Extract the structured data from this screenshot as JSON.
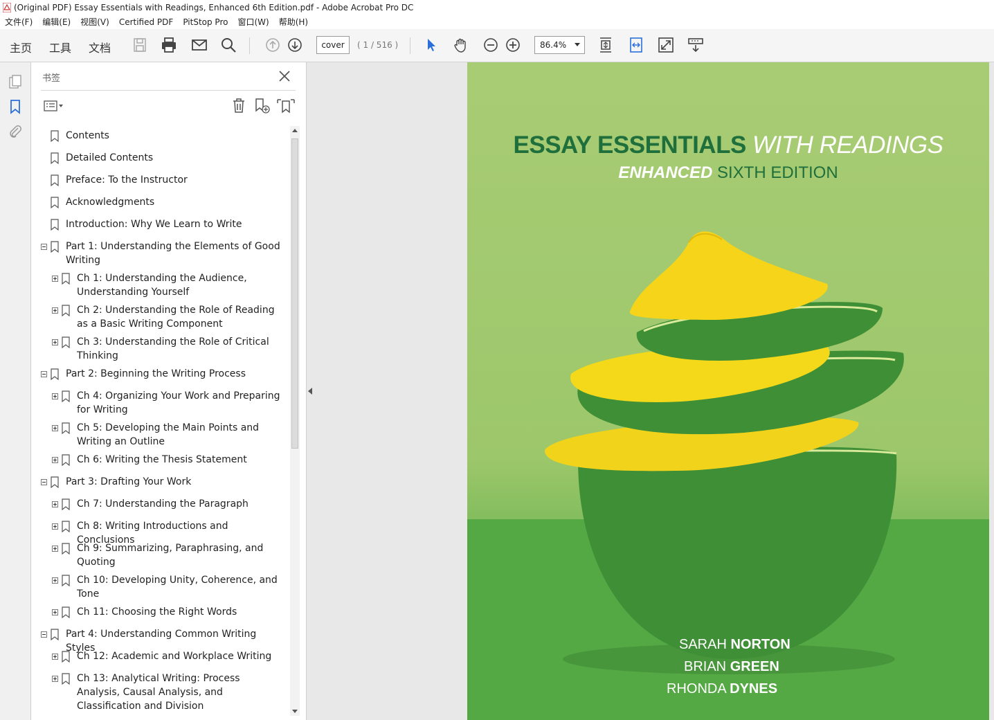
{
  "window": {
    "title": "(Original PDF) Essay Essentials with Readings, Enhanced 6th Edition.pdf - Adobe Acrobat Pro DC"
  },
  "menu": [
    "文件(F)",
    "编辑(E)",
    "视图(V)",
    "Certified PDF",
    "PitStop Pro",
    "窗口(W)",
    "帮助(H)"
  ],
  "toolbar": {
    "tabs": [
      "主页",
      "工具",
      "文档"
    ],
    "active_tab": "文档",
    "page_input": "cover",
    "page_count": "( 1 / 516 )",
    "zoom": "86.4%"
  },
  "panel": {
    "title": "书签"
  },
  "bookmarks": [
    {
      "label": "Contents",
      "level": 0,
      "expander": "none"
    },
    {
      "label": "Detailed Contents",
      "level": 0,
      "expander": "none"
    },
    {
      "label": "Preface: To the Instructor",
      "level": 0,
      "expander": "none"
    },
    {
      "label": "Acknowledgments",
      "level": 0,
      "expander": "none"
    },
    {
      "label": "Introduction: Why We Learn to Write",
      "level": 0,
      "expander": "none"
    },
    {
      "label": "Part 1: Understanding the Elements of Good Writing",
      "level": 0,
      "expander": "minus"
    },
    {
      "label": "Ch 1: Understanding the Audience, Understanding Yourself",
      "level": 1,
      "expander": "plus"
    },
    {
      "label": "Ch 2: Understanding the Role of Reading as a Basic Writing Component",
      "level": 1,
      "expander": "plus"
    },
    {
      "label": "Ch 3: Understanding the Role of Critical Thinking",
      "level": 1,
      "expander": "plus"
    },
    {
      "label": "Part 2: Beginning the Writing Process",
      "level": 0,
      "expander": "minus"
    },
    {
      "label": "Ch 4: Organizing Your Work and Preparing for Writing",
      "level": 1,
      "expander": "plus"
    },
    {
      "label": "Ch 5: Developing the Main Points and Writing an Outline",
      "level": 1,
      "expander": "plus"
    },
    {
      "label": "Ch 6: Writing the Thesis Statement",
      "level": 1,
      "expander": "plus"
    },
    {
      "label": "Part 3: Drafting Your Work",
      "level": 0,
      "expander": "minus"
    },
    {
      "label": "Ch 7: Understanding the Paragraph",
      "level": 1,
      "expander": "plus"
    },
    {
      "label": "Ch 8: Writing Introductions and Conclusions",
      "level": 1,
      "expander": "plus"
    },
    {
      "label": "Ch 9: Summarizing, Paraphrasing, and Quoting",
      "level": 1,
      "expander": "plus"
    },
    {
      "label": "Ch 10: Developing Unity, Coherence, and Tone",
      "level": 1,
      "expander": "plus"
    },
    {
      "label": "Ch 11: Choosing the Right Words",
      "level": 1,
      "expander": "plus"
    },
    {
      "label": "Part 4: Understanding Common Writing Styles",
      "level": 0,
      "expander": "minus"
    },
    {
      "label": "Ch 12: Academic and Workplace Writing",
      "level": 1,
      "expander": "plus"
    },
    {
      "label": "Ch 13: Analytical Writing: Process Analysis, Causal Analysis, and Classification and Division",
      "level": 1,
      "expander": "plus"
    }
  ],
  "cover": {
    "title_bold": "ESSAY ESSENTIALS",
    "title_italic": "WITH READINGS",
    "sub_bold": "ENHANCED",
    "sub_normal": "SIXTH EDITION",
    "authors": [
      {
        "first": "SARAH",
        "last": "NORTON"
      },
      {
        "first": "BRIAN",
        "last": "GREEN"
      },
      {
        "first": "RHONDA",
        "last": "DYNES"
      }
    ]
  },
  "colors": {
    "cover_green_dark": "#1f6f3c",
    "cover_bg": "#a8cc74",
    "accent_blue": "#2a6fdb"
  }
}
